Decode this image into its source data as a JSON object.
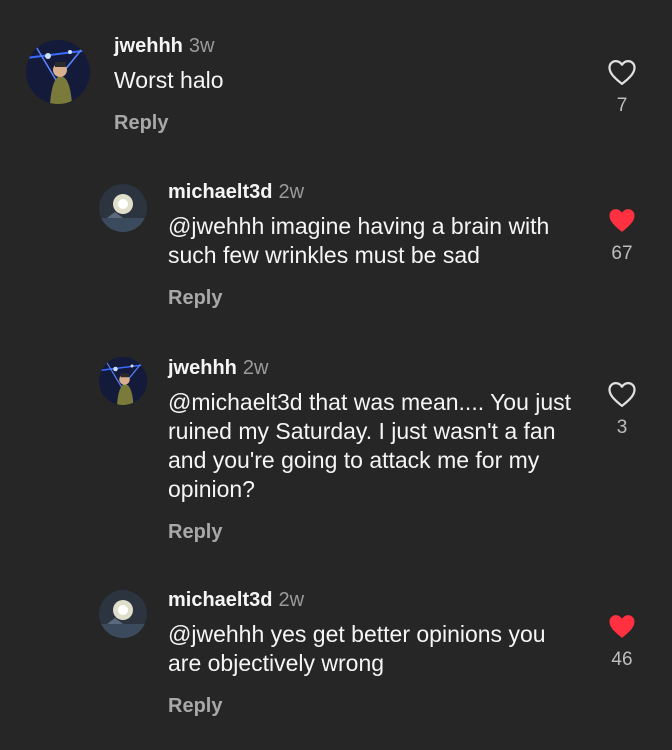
{
  "comments": [
    {
      "username": "jwehhh",
      "time": "3w",
      "text": "Worst halo",
      "reply_label": "Reply",
      "likes": "7",
      "liked": false,
      "avatar": "jwehhh-avatar"
    },
    {
      "username": "michaelt3d",
      "time": "2w",
      "text": "@jwehhh imagine having a brain with such few wrinkles must be sad",
      "reply_label": "Reply",
      "likes": "67",
      "liked": true,
      "avatar": "michaelt3d-avatar"
    },
    {
      "username": "jwehhh",
      "time": "2w",
      "text": "@michaelt3d that was mean.... You just ruined my Saturday. I just wasn't a fan and you're going to attack me for my opinion?",
      "reply_label": "Reply",
      "likes": "3",
      "liked": false,
      "avatar": "jwehhh-avatar"
    },
    {
      "username": "michaelt3d",
      "time": "2w",
      "text": "@jwehhh yes get better opinions you are objectively wrong",
      "reply_label": "Reply",
      "likes": "46",
      "liked": true,
      "avatar": "michaelt3d-avatar"
    }
  ],
  "colors": {
    "background": "#262626",
    "liked_heart": "#ff3040",
    "muted": "#9a9a9a"
  }
}
